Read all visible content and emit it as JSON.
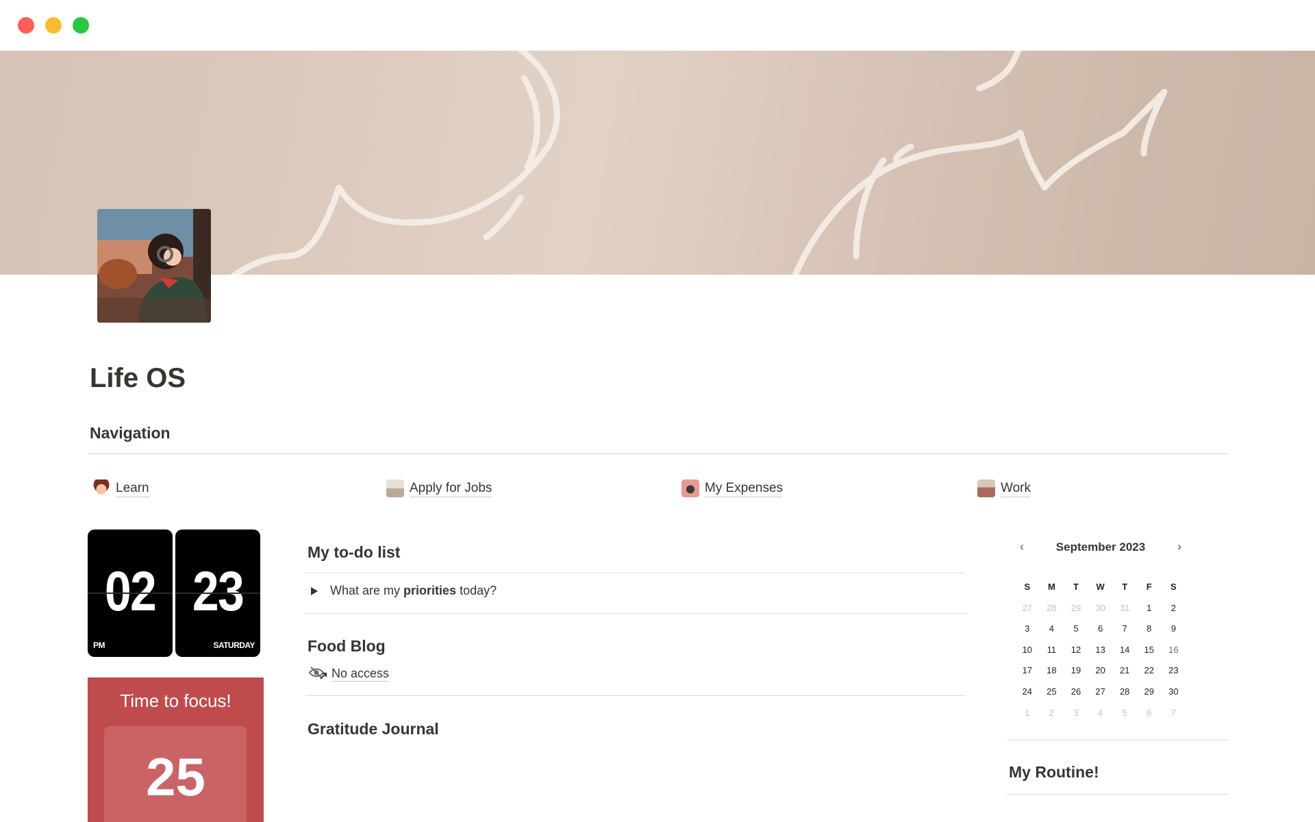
{
  "window": {
    "controls": [
      "close",
      "minimize",
      "maximize"
    ]
  },
  "page": {
    "title": "Life OS"
  },
  "navigation": {
    "heading": "Navigation",
    "links": [
      {
        "label": "Learn",
        "icon": "girl-avatar-icon"
      },
      {
        "label": "Apply for Jobs",
        "icon": "desk-image-icon"
      },
      {
        "label": "My Expenses",
        "icon": "wallet-image-icon"
      },
      {
        "label": "Work",
        "icon": "office-image-icon"
      }
    ]
  },
  "clock": {
    "hour": "02",
    "minute": "23",
    "period": "PM",
    "weekday": "SATURDAY"
  },
  "focus": {
    "title": "Time to focus!",
    "minutes": "25"
  },
  "todo": {
    "title": "My to-do list",
    "toggle_prefix": "What are my ",
    "toggle_bold": "priorities",
    "toggle_suffix": " today?"
  },
  "food_blog": {
    "title": "Food Blog",
    "access_label": "No access"
  },
  "gratitude": {
    "title": "Gratitude Journal"
  },
  "calendar": {
    "month_label": "September 2023",
    "prev": "‹",
    "next": "›",
    "weekdays": [
      "S",
      "M",
      "T",
      "W",
      "T",
      "F",
      "S"
    ],
    "weeks": [
      [
        "27",
        "28",
        "29",
        "30",
        "31",
        "1",
        "2"
      ],
      [
        "3",
        "4",
        "5",
        "6",
        "7",
        "8",
        "9"
      ],
      [
        "10",
        "11",
        "12",
        "13",
        "14",
        "15",
        "16"
      ],
      [
        "17",
        "18",
        "19",
        "20",
        "21",
        "22",
        "23"
      ],
      [
        "24",
        "25",
        "26",
        "27",
        "28",
        "29",
        "30"
      ],
      [
        "1",
        "2",
        "3",
        "4",
        "5",
        "6",
        "7"
      ]
    ]
  },
  "routine": {
    "title": "My Routine!"
  },
  "colors": {
    "focus_red": "#c04b4d",
    "text": "#37352f",
    "divider": "#dcdad5"
  }
}
